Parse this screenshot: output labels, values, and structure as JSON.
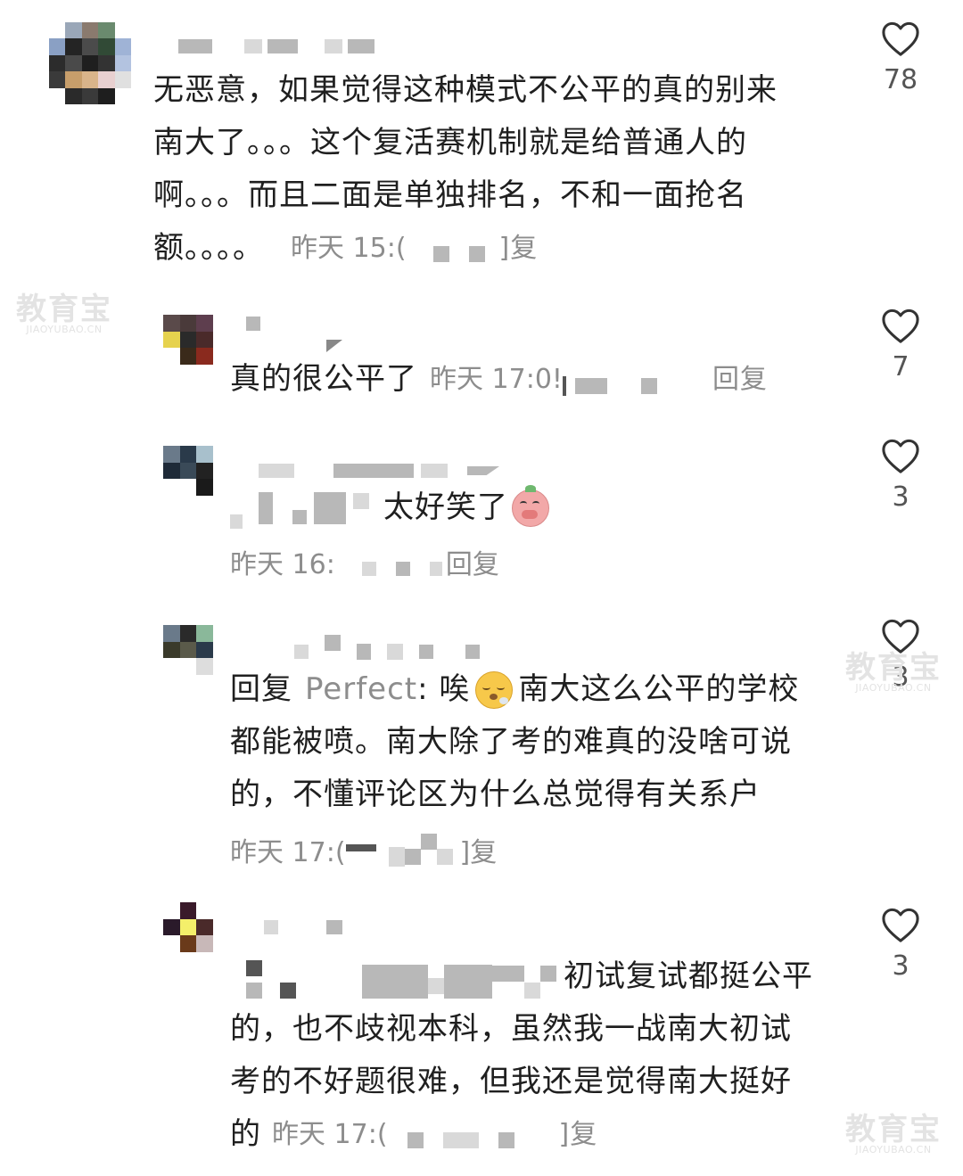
{
  "comments": [
    {
      "lines": [
        "无恶意，如果觉得这种模式不公平的真的别来",
        "南大了。。。这个复活赛机制就是给普通人的",
        "啊。。。而且二面是单独排名，不和一面抢名",
        "额。。。。"
      ],
      "time": "昨天 15:(",
      "reply": "]复",
      "likes": "78"
    },
    {
      "text": "真的很公平了",
      "time": "昨天 17:0!",
      "reply": "回复",
      "likes": "7"
    },
    {
      "text": "太好笑了",
      "time": "昨天 16:",
      "reply": "回复",
      "likes": "3"
    },
    {
      "reply_prefix": "回复",
      "mention": "Perfect",
      "colon": ": 唉",
      "line1_rest": "南大这么公平的学校",
      "lines": [
        "都能被喷。南大除了考的难真的没啥可说",
        "的，不懂评论区为什么总觉得有关系户"
      ],
      "time": "昨天 17:(",
      "reply": "]复",
      "likes": "3"
    },
    {
      "line1_tail": "初试复试都挺公平",
      "lines": [
        "的，也不歧视本科，虽然我一战南大初试",
        "考的不好题很难，但我还是觉得南大挺好",
        "的"
      ],
      "time": "昨天 17:(",
      "reply": "]复",
      "likes": "3"
    }
  ],
  "watermark": {
    "main": "教育宝",
    "sub": "JIAOYUBAO.CN"
  },
  "icons": {
    "like": "heart-outline-icon",
    "emoji_a": "pig-laugh-emoji-icon",
    "emoji_b": "sigh-face-emoji-icon"
  },
  "colors": {
    "text": "#1f1f1f",
    "meta": "#8d8d8d",
    "heart": "#333333"
  }
}
